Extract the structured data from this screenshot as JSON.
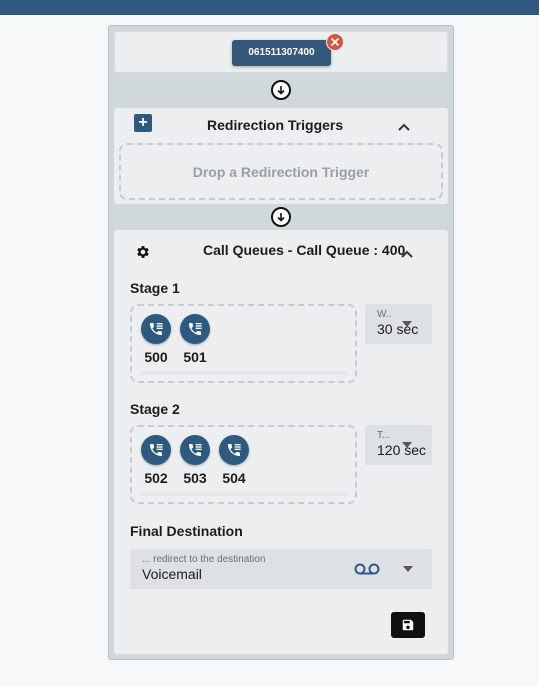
{
  "number_card": {
    "number": "061511307400"
  },
  "triggers": {
    "title": "Redirection Triggers",
    "add_label": "+",
    "drop_placeholder": "Drop a Redirection Trigger"
  },
  "queue": {
    "title": "Call Queues - Call Queue : 400",
    "stages": [
      {
        "label": "Stage 1",
        "agents": [
          "500",
          "501"
        ],
        "time_label": "W..",
        "time_value": "30 sec"
      },
      {
        "label": "Stage 2",
        "agents": [
          "502",
          "503",
          "504"
        ],
        "time_label": "T...",
        "time_value": "120 sec"
      }
    ],
    "final_destination": {
      "label": "Final Destination",
      "field_label": "... redirect to the destination",
      "value": "Voicemail",
      "icon": "voicemail-icon"
    }
  },
  "icons": {
    "close": "close-icon",
    "connector": "arrow-down-circle-icon",
    "collapse": "chevron-up-icon",
    "settings": "gear-icon",
    "agent": "phone-icon",
    "save": "save-icon"
  },
  "colors": {
    "topbar": "#2e5a82",
    "chip": "#34587a",
    "close": "#d9533f"
  }
}
